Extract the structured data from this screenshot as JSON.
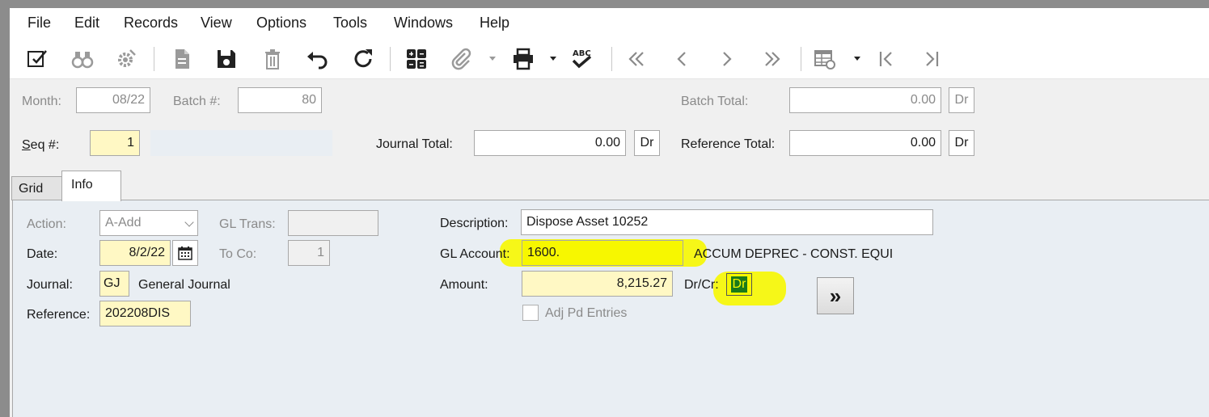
{
  "menu": [
    "File",
    "Edit",
    "Records",
    "View",
    "Options",
    "Tools",
    "Windows",
    "Help"
  ],
  "toolbar": {
    "icons": [
      "edit-icon",
      "binoculars-icon",
      "settings-icon",
      "new-document-icon",
      "save-icon",
      "delete-icon",
      "undo-icon",
      "refresh-icon",
      "calculator-icon",
      "attachment-icon",
      "print-icon",
      "spellcheck-icon",
      "first-record-icon",
      "previous-record-icon",
      "next-record-icon",
      "last-record-icon",
      "grid-settings-icon",
      "collapse-left-icon",
      "expand-right-icon"
    ],
    "spellcheck_text": "ABC"
  },
  "header": {
    "month_label": "Month:",
    "month_value": "08/22",
    "batch_label": "Batch #:",
    "batch_value": "80",
    "batch_total_label": "Batch Total:",
    "batch_total_value": "0.00",
    "batch_total_drcr": "Dr",
    "seq_label_pre": "S",
    "seq_label_post": "eq #:",
    "seq_value": "1",
    "journal_total_label": "Journal Total:",
    "journal_total_value": "0.00",
    "journal_total_drcr": "Dr",
    "reference_total_label": "Reference Total:",
    "reference_total_value": "0.00",
    "reference_total_drcr": "Dr"
  },
  "tabs": [
    {
      "label": "Grid",
      "active": false
    },
    {
      "label": "Info",
      "active": true
    }
  ],
  "info": {
    "action_label": "Action:",
    "action_value": "A-Add",
    "gl_trans_label": "GL Trans:",
    "gl_trans_value": "",
    "date_label": "Date:",
    "date_value": "8/2/22",
    "to_co_label": "To Co:",
    "to_co_value": "1",
    "journal_label": "Journal:",
    "journal_value": "GJ",
    "journal_name": "General Journal",
    "reference_label": "Reference:",
    "reference_value": "202208DIS",
    "description_label": "Description:",
    "description_value": "Dispose Asset 10252",
    "gl_account_label": "GL Account:",
    "gl_account_value": "1600.",
    "gl_account_name": "ACCUM DEPREC - CONST. EQUI",
    "amount_label": "Amount:",
    "amount_value": "8,215.27",
    "drcr_label": "Dr/Cr:",
    "drcr_value": "Dr",
    "adj_label": "Adj Pd Entries",
    "goto_label": "»"
  },
  "colors": {
    "highlight": "#f7f700",
    "required_field": "#fff8c4",
    "panel": "#e9eef3"
  }
}
